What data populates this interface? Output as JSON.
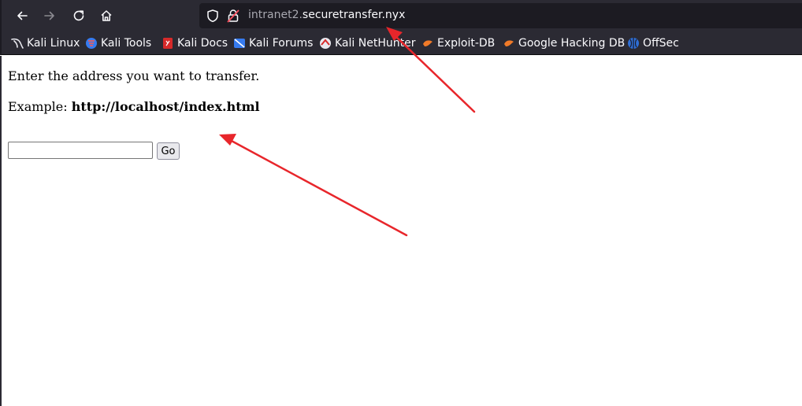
{
  "browser": {
    "url_prefix": "intranet2.",
    "url_domain": "securetransfer.nyx"
  },
  "bookmarks": [
    {
      "label": "Kali Linux",
      "icon": "kali-dragon-icon"
    },
    {
      "label": "Kali Tools",
      "icon": "kali-tools-icon"
    },
    {
      "label": "Kali Docs",
      "icon": "kali-docs-icon"
    },
    {
      "label": "Kali Forums",
      "icon": "kali-forums-icon"
    },
    {
      "label": "Kali NetHunter",
      "icon": "kali-nethunter-icon"
    },
    {
      "label": "Exploit-DB",
      "icon": "exploit-db-icon"
    },
    {
      "label": "Google Hacking DB",
      "icon": "google-hacking-db-icon"
    },
    {
      "label": "OffSec",
      "icon": "offsec-icon"
    }
  ],
  "page": {
    "instruction": "Enter the address you want to transfer.",
    "example_label": "Example: ",
    "example_value": "http://localhost/index.html",
    "input_value": "",
    "go_label": "Go"
  },
  "annotations": {
    "arrow_color": "#e8262b"
  },
  "colors": {
    "chrome_bg": "#2b2a33",
    "urlbar_bg": "#1c1b22"
  }
}
